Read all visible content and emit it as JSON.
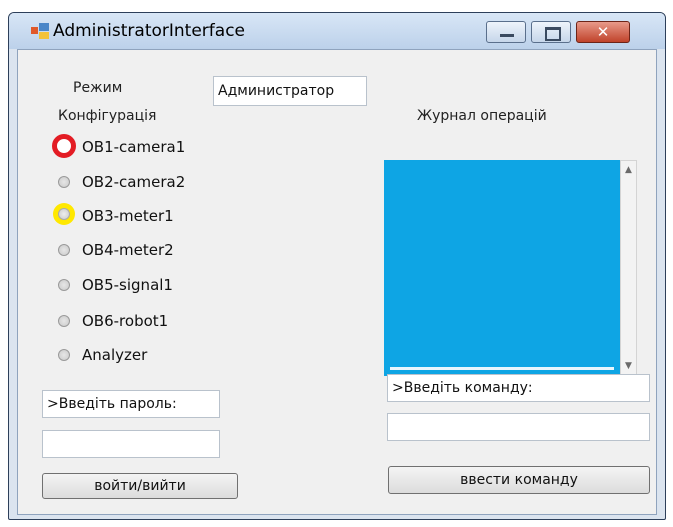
{
  "window": {
    "title": "AdministratorInterface",
    "minimize_glyph": "",
    "maximize_glyph": "",
    "close_glyph": "✕"
  },
  "mode": {
    "label": "Режим",
    "value": "Администратор"
  },
  "config": {
    "label": "Конфігурація",
    "options": [
      {
        "label": "OB1-camera1",
        "state": "highlighted-red"
      },
      {
        "label": "OB2-camera2",
        "state": "normal"
      },
      {
        "label": "OB3-meter1",
        "state": "highlighted-yellow"
      },
      {
        "label": "OB4-meter2",
        "state": "normal"
      },
      {
        "label": "OB5-signal1",
        "state": "normal"
      },
      {
        "label": "OB6-robot1",
        "state": "normal"
      },
      {
        "label": "Analyzer",
        "state": "normal"
      }
    ]
  },
  "password": {
    "prompt": ">Введіть пароль:",
    "value": ""
  },
  "login_button": "войти/вийти",
  "log": {
    "label": "Журнал операцій",
    "color": "#0ea5e4"
  },
  "command": {
    "prompt": ">Введіть команду:",
    "value": ""
  },
  "submit_button": "ввести команду",
  "colors": {
    "highlight_red": "#e31c24",
    "highlight_yellow": "#ffe800"
  }
}
